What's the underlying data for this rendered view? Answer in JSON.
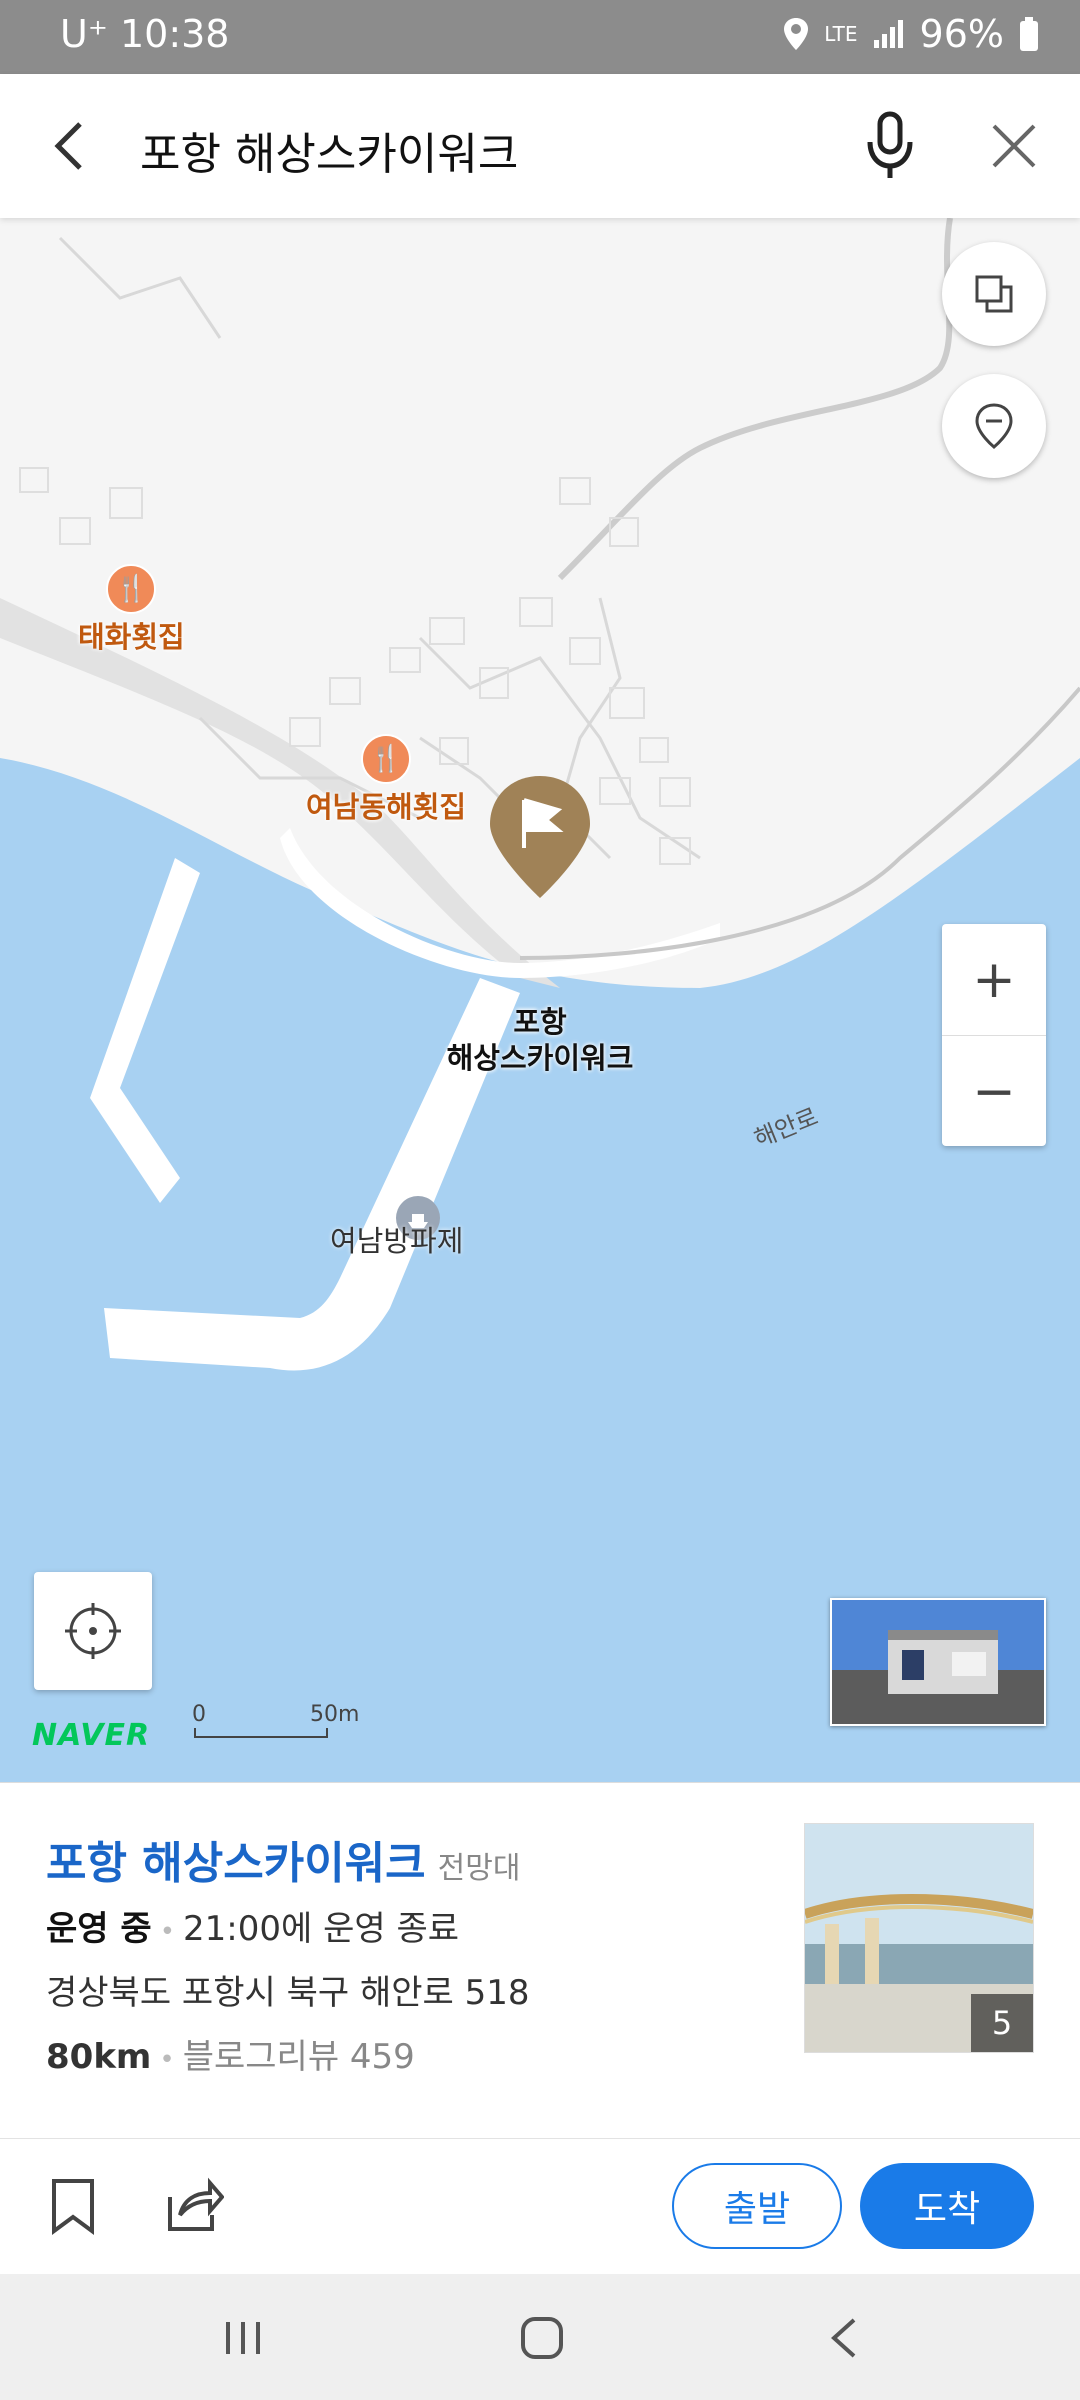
{
  "status_bar": {
    "carrier": "U⁺",
    "time": "10:38",
    "network": "LTE",
    "battery": "96%"
  },
  "search": {
    "query": "포항 해상스카이워크"
  },
  "map": {
    "pois": [
      {
        "name": "태화횟집",
        "type": "restaurant"
      },
      {
        "name": "여남동해횟집",
        "type": "restaurant"
      }
    ],
    "marker_label_line1": "포항",
    "marker_label_line2": "해상스카이워크",
    "ferry_label": "여남방파제",
    "road_label": "해안로",
    "zoom_in": "+",
    "zoom_out": "−",
    "brand": "NAVER",
    "scale_zero": "0",
    "scale_value": "50m",
    "colors": {
      "water": "#a8d1f2",
      "land": "#f5f5f5",
      "marker": "#a08257",
      "brand": "#03c75a"
    }
  },
  "place": {
    "name": "포항 해상스카이워크",
    "category": "전망대",
    "status": "운영 중",
    "hours": "21:00에 운영 종료",
    "address": "경상북도 포항시 북구 해안로 518",
    "distance": "80km",
    "reviews": "블로그리뷰 459",
    "photo_count": "5"
  },
  "actions": {
    "depart": "출발",
    "arrive": "도착",
    "accent": "#1a7be8"
  }
}
